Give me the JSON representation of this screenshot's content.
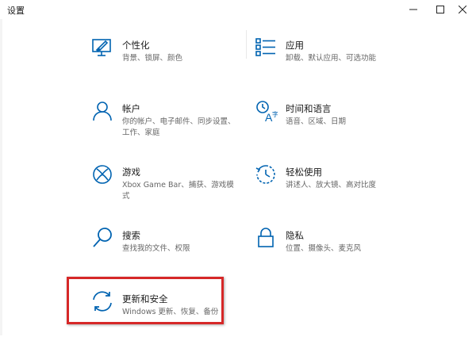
{
  "window": {
    "title": "设置"
  },
  "tiles": [
    {
      "icon": "personalization-icon",
      "name": "个性化",
      "desc": "背景、锁屏、颜色"
    },
    {
      "icon": "apps-icon",
      "name": "应用",
      "desc": "卸载、默认应用、可选功能"
    },
    {
      "icon": "accounts-icon",
      "name": "帐户",
      "desc": "你的帐户、电子邮件、同步设置、工作、家庭"
    },
    {
      "icon": "time-language-icon",
      "name": "时间和语言",
      "desc": "语音、区域、日期"
    },
    {
      "icon": "gaming-icon",
      "name": "游戏",
      "desc": "Xbox Game Bar、捕获、游戏模式"
    },
    {
      "icon": "ease-of-access-icon",
      "name": "轻松使用",
      "desc": "讲述人、放大镜、高对比度"
    },
    {
      "icon": "search-icon",
      "name": "搜索",
      "desc": "查找我的文件、权限"
    },
    {
      "icon": "privacy-icon",
      "name": "隐私",
      "desc": "位置、摄像头、麦克风"
    },
    {
      "icon": "update-security-icon",
      "name": "更新和安全",
      "desc": "Windows 更新、恢复、备份"
    }
  ],
  "colors": {
    "accent": "#0063b1",
    "highlight": "#d62828"
  }
}
